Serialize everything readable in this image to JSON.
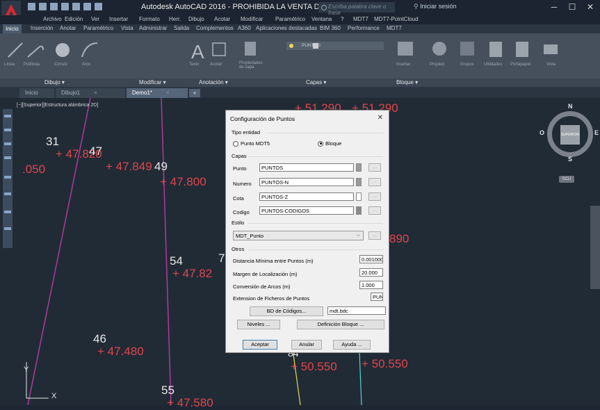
{
  "window": {
    "title": "Autodesk AutoCAD 2016 - PROHIBIDA LA VENTA    Demo1.dwg",
    "search_placeholder": "Escriba palabra clave o frase",
    "signin": "Iniciar sesión",
    "minimize": "─",
    "maximize": "☐",
    "close": "✕"
  },
  "menubar": [
    "Archivo",
    "Edición",
    "Ver",
    "Insertar",
    "Formato",
    "Herr.",
    "Dibujo",
    "Acotar",
    "Modificar",
    "Paramétrico",
    "Ventana",
    "?",
    "MDT7",
    "MDT7-PointCloud"
  ],
  "ribbon_tabs": [
    "Inicio",
    "Inserción",
    "Anotar",
    "Paramétrico",
    "Vista",
    "Administrar",
    "Salida",
    "Complementos",
    "A360",
    "Aplicaciones destacadas",
    "BIM 360",
    "Performance",
    "MDT7"
  ],
  "ribbon_tools": {
    "line": "Línea",
    "polyline": "Polilínea",
    "circle": "Círculo",
    "arc": "Arco",
    "text": "Texto",
    "dimension": "Acotar",
    "layer_props": "Propiedades de capa",
    "insert": "Insertar",
    "properties": "Propied.",
    "groups": "Grupos",
    "utilities": "Utilidades",
    "clipboard": "Portapapel.",
    "view": "Vista",
    "layer_current": "PUNTOS"
  },
  "ribbon_panels": [
    "Dibujo ▾",
    "Modificar ▾",
    "Anotación ▾",
    "Capas ▾",
    "Bloque ▾"
  ],
  "doc_tabs": [
    "Inicio",
    "Dibujo1",
    "Demo1*"
  ],
  "tab_close": "×",
  "tab_add": "+",
  "view_label": "[−][Superior][Estructura alámbrica 2D]",
  "viewcube": {
    "face": "SUPERIOR",
    "n": "N",
    "s": "S",
    "e": "E",
    "o": "O",
    "wcs": "SCU"
  },
  "ucs": {
    "x": "X",
    "y": "Y"
  },
  "cad_labels": {
    "p31": "31",
    "v31": "+ 47.820",
    "p47": "47",
    "v47": "+ 47.849",
    "p049": "49",
    "v050": ".050",
    "v800": "+ 47.800",
    "p54": "54",
    "v54": "+ 47.82",
    "p7": "7",
    "p46": "46",
    "v46": "+ 47.480",
    "p55": "55",
    "v55": "+ 47.580",
    "top1": "+ 51.290",
    "top2": "+ 51.290",
    "v890": "890",
    "p84": "84",
    "v84": "+ 50.550",
    "v85": "+ 50.550"
  },
  "dialog": {
    "title": "Configuración de Puntos",
    "close": "✕",
    "tipo_entidad": "Tipo entidad",
    "opt_punto": "Punto MDT5",
    "opt_bloque": "Bloque",
    "capas": "Capas",
    "layers": [
      {
        "label": "Punto",
        "value": "PUNTOS",
        "swatch": "#9a9a9a"
      },
      {
        "label": "Numero",
        "value": "PUNTOS-N",
        "swatch": "#9a9a9a"
      },
      {
        "label": "Cota",
        "value": "PUNTOS-Z",
        "swatch": "#ffffff"
      },
      {
        "label": "Codigo",
        "value": "PUNTOS-CODIGOS",
        "swatch": "#8a8a8a"
      }
    ],
    "dots": "...",
    "estilo": "Estilo",
    "estilo_value": "MDT_Punto",
    "otros": "Otros",
    "options": [
      {
        "label": "Distancia Mínima entre Puntos (m)",
        "value": "0.001000"
      },
      {
        "label": "Margen de Localización (m)",
        "value": "20.000"
      },
      {
        "label": "Conversión de Arcos (m)",
        "value": "1.000"
      },
      {
        "label": "Extension de Ficheros de Puntos",
        "value": "PUN"
      }
    ],
    "bd_codigos": "BD de Códigos...",
    "bd_file": "mdt.bdc",
    "niveles": "Niveles ...",
    "def_bloque": "Definición Bloque ...",
    "aceptar": "Aceptar",
    "anular": "Anular",
    "ayuda": "Ayuda ..."
  }
}
